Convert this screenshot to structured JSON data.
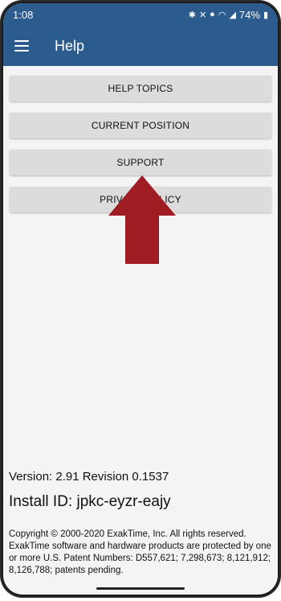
{
  "status": {
    "time": "1:08",
    "battery": "74%",
    "icons": [
      "bluetooth-icon",
      "mute-icon",
      "location-icon",
      "wifi-icon",
      "signal-icon",
      "battery-icon"
    ]
  },
  "appbar": {
    "title": "Help",
    "menu_icon": "hamburger-menu-icon"
  },
  "menu": [
    {
      "label": "HELP TOPICS"
    },
    {
      "label": "CURRENT POSITION"
    },
    {
      "label": "SUPPORT"
    },
    {
      "label": "PRIVACY POLICY"
    }
  ],
  "annotation": {
    "icon": "red-arrow-up-icon",
    "color": "#a01c23"
  },
  "info": {
    "version": "Version: 2.91 Revision 0.1537",
    "install_id": "Install ID: jpkc-eyzr-eajy",
    "copyright": "Copyright © 2000-2020 ExakTime, Inc.  All rights reserved. ExakTime software and hardware products are protected by one or more U.S. Patent Numbers: D557,621; 7,298,673; 8,121,912; 8,126,788; patents pending."
  },
  "colors": {
    "appbar": "#2c5b8e",
    "background": "#f4f4f4",
    "button": "#dcdcdc"
  }
}
